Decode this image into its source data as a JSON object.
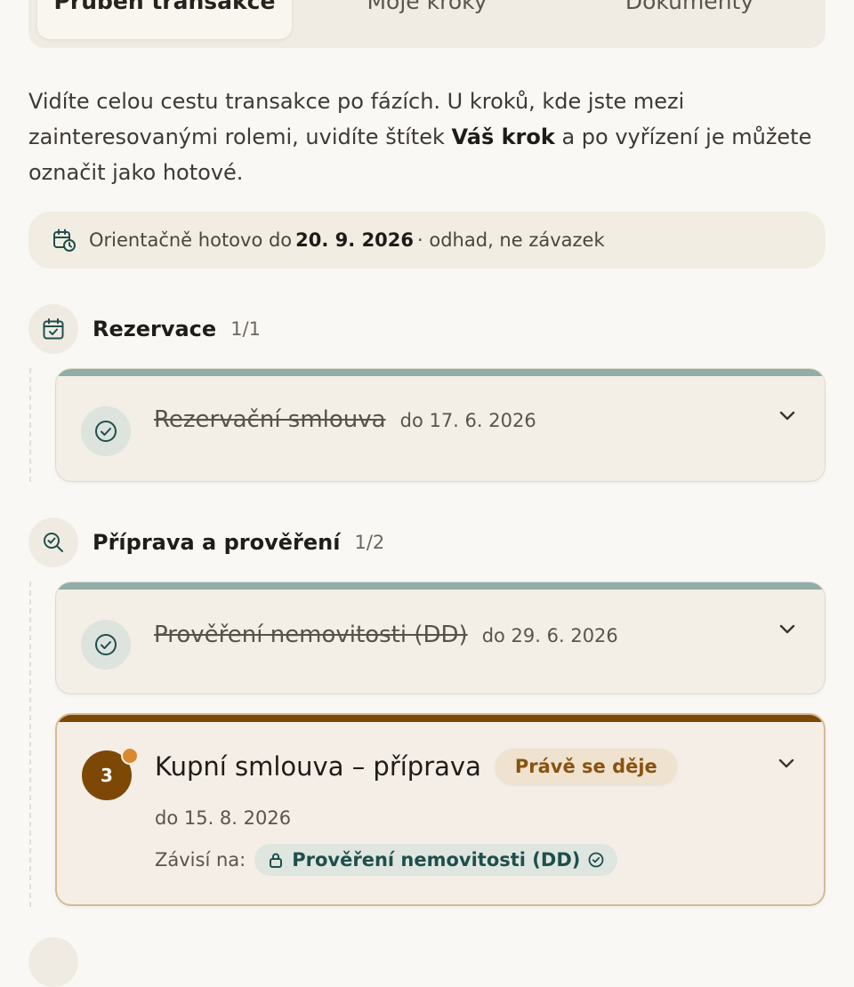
{
  "tabs": [
    {
      "label": "Průběh transakce",
      "active": true
    },
    {
      "label": "Moje kroky",
      "active": false
    },
    {
      "label": "Dokumenty",
      "active": false
    }
  ],
  "intro": {
    "text_before": "Vidíte celou cestu transakce po fázích. U kroků, kde jste mezi zainteresovanými rolemi, uvidíte štítek ",
    "highlight": "Váš krok",
    "text_after": " a po vyřízení je můžete označit jako hotové."
  },
  "estimate": {
    "prefix": "Orientačně hotovo do",
    "date": "20. 9. 2026",
    "suffix": "· odhad, ne závazek"
  },
  "phases": [
    {
      "title": "Rezervace",
      "count": "1/1",
      "icon": "calendar-check-icon",
      "steps": [
        {
          "title": "Rezervační smlouva",
          "due": "do 17. 6. 2026",
          "done": true
        }
      ]
    },
    {
      "title": "Příprava a prověření",
      "count": "1/2",
      "icon": "search-check-icon",
      "steps": [
        {
          "title": "Prověření nemovitosti (DD)",
          "due": "do 29. 6. 2026",
          "done": true
        },
        {
          "number": "3",
          "title": "Kupní smlouva – příprava",
          "badge": "Právě se děje",
          "due": "do 15. 8. 2026",
          "depends_label": "Závisí na:",
          "depends_on": "Prověření nemovitosti (DD)",
          "done": false
        }
      ]
    }
  ],
  "colors": {
    "accent_current": "#7d4706",
    "done_bar": "#90aea6",
    "badge_text": "#8a5210",
    "dependency_text": "#1f4f4c"
  }
}
